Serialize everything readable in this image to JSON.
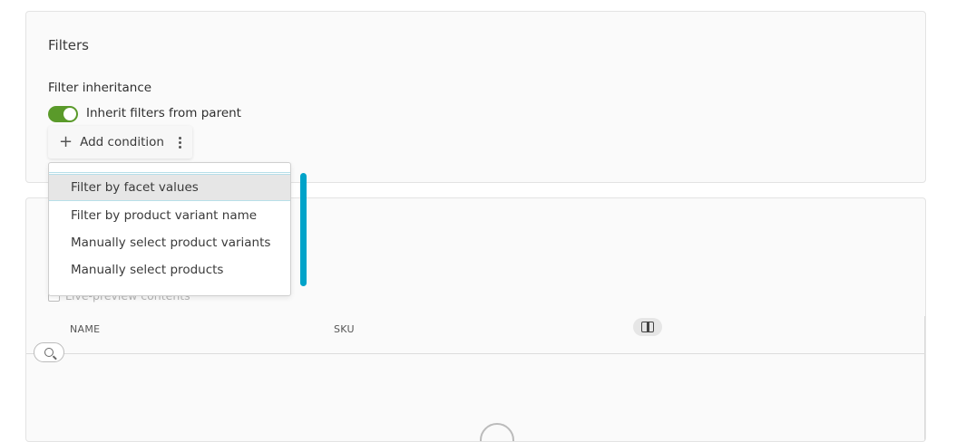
{
  "filters": {
    "title": "Filters",
    "inheritance_label": "Filter inheritance",
    "toggle": {
      "label": "Inherit filters from parent",
      "on": true,
      "color": "#5a9a2a"
    },
    "add_condition_label": "Add condition"
  },
  "dropdown": {
    "items": [
      {
        "label": "Filter by facet values",
        "active": true
      },
      {
        "label": "Filter by product variant name",
        "active": false
      },
      {
        "label": "Manually select product variants",
        "active": false
      },
      {
        "label": "Manually select products",
        "active": false
      }
    ],
    "accent": "#00a3c9"
  },
  "contents": {
    "live_preview_label": "Live-preview contents",
    "columns": [
      "NAME",
      "SKU"
    ]
  },
  "icons": [
    "plus-icon",
    "kebab-icon",
    "columns-icon",
    "search-icon"
  ]
}
